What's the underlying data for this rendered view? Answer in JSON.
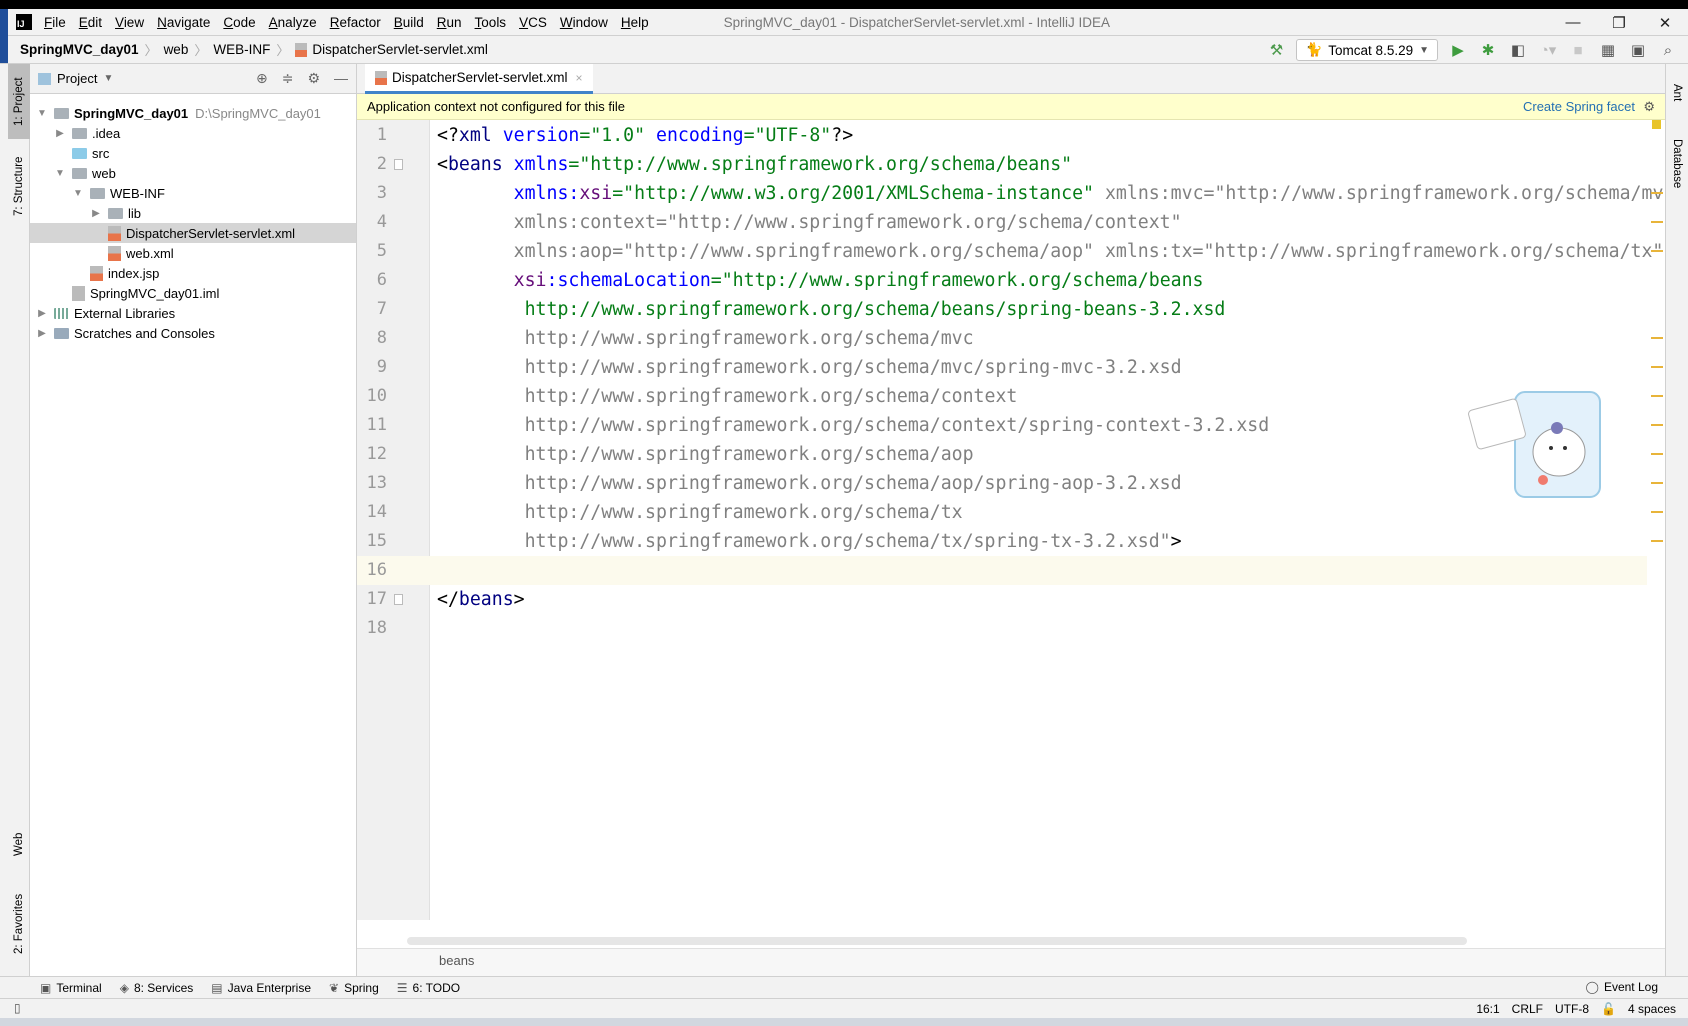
{
  "window": {
    "title": "SpringMVC_day01 - DispatcherServlet-servlet.xml - IntelliJ IDEA",
    "logo": "IJ",
    "minimize": "—",
    "restore": "❐",
    "close": "✕"
  },
  "menu": [
    "File",
    "Edit",
    "View",
    "Navigate",
    "Code",
    "Analyze",
    "Refactor",
    "Build",
    "Run",
    "Tools",
    "VCS",
    "Window",
    "Help"
  ],
  "breadcrumb": [
    "SpringMVC_day01",
    "web",
    "WEB-INF",
    "DispatcherServlet-servlet.xml"
  ],
  "toolbar": {
    "run_config": "Tomcat 8.5.29",
    "icons": [
      "build-hammer-icon",
      "run-icon",
      "debug-icon",
      "coverage-icon",
      "profile-icon",
      "stop-icon",
      "project-structure-icon",
      "presentation-icon",
      "search-icon"
    ]
  },
  "left_tabs": {
    "project": "1: Project",
    "structure": "7: Structure",
    "web": "Web",
    "favorites": "2: Favorites"
  },
  "right_tabs": {
    "ant": "Ant",
    "database": "Database"
  },
  "project": {
    "title": "Project",
    "tree": [
      {
        "label": "SpringMVC_day01",
        "path": "D:\\SpringMVC_day01",
        "depth": 0,
        "expanded": true,
        "type": "module"
      },
      {
        "label": ".idea",
        "depth": 1,
        "expanded": false,
        "type": "folder"
      },
      {
        "label": "src",
        "depth": 1,
        "type": "src-folder"
      },
      {
        "label": "web",
        "depth": 1,
        "expanded": true,
        "type": "web-folder"
      },
      {
        "label": "WEB-INF",
        "depth": 2,
        "expanded": true,
        "type": "folder"
      },
      {
        "label": "lib",
        "depth": 3,
        "expanded": false,
        "type": "folder"
      },
      {
        "label": "DispatcherServlet-servlet.xml",
        "depth": 3,
        "type": "xml",
        "selected": true
      },
      {
        "label": "web.xml",
        "depth": 3,
        "type": "xml"
      },
      {
        "label": "index.jsp",
        "depth": 2,
        "type": "jsp"
      },
      {
        "label": "SpringMVC_day01.iml",
        "depth": 1,
        "type": "iml"
      },
      {
        "label": "External Libraries",
        "depth": 0,
        "expanded": false,
        "type": "libs"
      },
      {
        "label": "Scratches and Consoles",
        "depth": 0,
        "expanded": false,
        "type": "scratches"
      }
    ]
  },
  "editor": {
    "tab": "DispatcherServlet-servlet.xml",
    "tab_close": "×",
    "banner": {
      "text": "Application context not configured for this file",
      "link": "Create Spring facet"
    },
    "current_line": 16,
    "lines": [
      [
        [
          "<?",
          "br"
        ],
        [
          "xml ",
          "tag"
        ],
        [
          "version",
          "attr"
        ],
        [
          "=\"1.0\" ",
          "val"
        ],
        [
          "encoding",
          "attr"
        ],
        [
          "=\"UTF-8\"",
          "val"
        ],
        [
          "?>",
          "br"
        ]
      ],
      [
        [
          "<",
          "br"
        ],
        [
          "beans ",
          "tag"
        ],
        [
          "xmlns",
          "attr"
        ],
        [
          "=\"http://www.springframework.org/schema/beans\"",
          "val"
        ]
      ],
      [
        [
          "       ",
          ""
        ],
        [
          "xmlns:",
          "attr"
        ],
        [
          "xsi",
          "ns"
        ],
        [
          "=\"http://www.w3.org/2001/XMLSchema-instance\" ",
          "val"
        ],
        [
          "xmlns:mvc=\"http://www.springframework.org/schema/mv",
          "gray"
        ]
      ],
      [
        [
          "       xmlns:context=\"http://www.springframework.org/schema/context\"",
          "gray"
        ]
      ],
      [
        [
          "       xmlns:aop=\"http://www.springframework.org/schema/aop\" xmlns:tx=\"http://www.springframework.org/schema/tx\"",
          "gray"
        ]
      ],
      [
        [
          "       ",
          ""
        ],
        [
          "xsi",
          "ns"
        ],
        [
          ":schemaLocation",
          "attr"
        ],
        [
          "=\"http://www.springframework.org/schema/beans",
          "val"
        ]
      ],
      [
        [
          "        http://www.springframework.org/schema/beans/spring-beans-3.2.xsd",
          "val"
        ]
      ],
      [
        [
          "        http://www.springframework.org/schema/mvc",
          "gray"
        ]
      ],
      [
        [
          "        http://www.springframework.org/schema/mvc/spring-mvc-3.2.xsd",
          "gray"
        ]
      ],
      [
        [
          "        http://www.springframework.org/schema/context",
          "gray"
        ]
      ],
      [
        [
          "        http://www.springframework.org/schema/context/spring-context-3.2.xsd",
          "gray"
        ]
      ],
      [
        [
          "        http://www.springframework.org/schema/aop",
          "gray"
        ]
      ],
      [
        [
          "        http://www.springframework.org/schema/aop/spring-aop-3.2.xsd",
          "gray"
        ]
      ],
      [
        [
          "        http://www.springframework.org/schema/tx",
          "gray"
        ]
      ],
      [
        [
          "        http://www.springframework.org/schema/tx/spring-tx-3.2.xsd\"",
          "gray"
        ],
        [
          ">",
          "br"
        ]
      ],
      [],
      [
        [
          "</",
          "br"
        ],
        [
          "beans",
          "tag"
        ],
        [
          ">",
          "br"
        ]
      ],
      []
    ],
    "breadcrumb": "beans"
  },
  "tool_windows": [
    {
      "label": "Terminal",
      "icon": "terminal-icon"
    },
    {
      "label": "8: Services",
      "icon": "services-icon"
    },
    {
      "label": "Java Enterprise",
      "icon": "java-enterprise-icon"
    },
    {
      "label": "Spring",
      "icon": "spring-icon"
    },
    {
      "label": "6: TODO",
      "icon": "todo-icon"
    }
  ],
  "event_log": "Event Log",
  "status": {
    "position": "16:1",
    "line_sep": "CRLF",
    "encoding": "UTF-8",
    "indent": "4 spaces"
  }
}
